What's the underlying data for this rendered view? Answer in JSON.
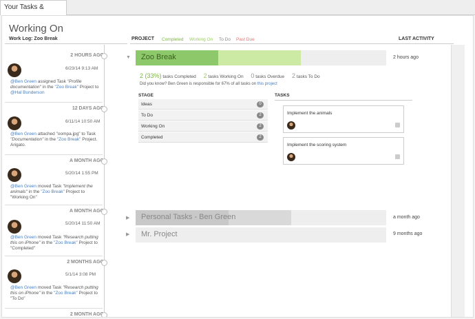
{
  "tab": {
    "label": "Your Tasks & Projects"
  },
  "header": {
    "title": "Working On",
    "worklog": "Work Log: Zoo Break",
    "project_col": "PROJECT",
    "legend": {
      "completed": "Completed",
      "working_on": "Working On",
      "to_do": "To Do",
      "past_due": "Past Due"
    },
    "activity_col": "LAST ACTIVITY"
  },
  "colors": {
    "completed": "#8dc96b",
    "working_on": "#cdeaa5",
    "past_due": "#e57373",
    "link": "#4a7fc0"
  },
  "feed": [
    {
      "time": "2 HOURS AGO",
      "date": "6/23/14 9:13 AM",
      "user": "@Ben Green",
      "action": " assigned Task ",
      "item": "\"Profile documentation\"",
      "mid": " in the ",
      "project": "\"Zoo Break\"",
      "tail": " Project to ",
      "target": "@Hal Bunderson",
      "end": ""
    },
    {
      "time": "12 DAYS AGO",
      "date": "6/11/14 10:50 AM",
      "user": "@Ben Green",
      "action": " attached \"oompa.jpg\" to Task ",
      "item": "\"Documentation\"",
      "mid": " in the ",
      "project": "\"Zoo Break\"",
      "tail": " Project. Arigato.",
      "target": "",
      "end": ""
    },
    {
      "time": "A MONTH AGO",
      "date": "5/20/14 1:55 PM",
      "user": "@Ben Green",
      "action": " moved Task ",
      "item": "\"Implement the animals\"",
      "mid": " in the ",
      "project": "\"Zoo Break\"",
      "tail": " Project to \"Working On\"",
      "target": "",
      "end": ""
    },
    {
      "time": "A MONTH AGO",
      "date": "5/20/14 11:50 AM",
      "user": "@Ben Green",
      "action": " moved Task ",
      "item": "\"Research putting this on iPhone\"",
      "mid": " in the ",
      "project": "\"Zoo Break\"",
      "tail": " Project to \"Completed\"",
      "target": "",
      "end": ""
    },
    {
      "time": "2 MONTHS AGO",
      "date": "5/1/14 3:08 PM",
      "user": "@Ben Green",
      "action": " moved Task ",
      "item": "\"Research putting this on iPhone\"",
      "mid": " in the ",
      "project": "\"Zoo Break\"",
      "tail": " Project to \"To Do\"",
      "target": "",
      "end": ""
    },
    {
      "time": "2 MONTH AGO"
    }
  ],
  "projects": [
    {
      "name": "Zoo Break",
      "activity": "2 hours ago",
      "completed_fraction": 0.33,
      "working_fraction": 0.33,
      "stats": {
        "completed": "2 (33%)",
        "completed_label": " tasks Completed",
        "working": "2",
        "working_label": " tasks Working On",
        "overdue": "0",
        "overdue_label": " tasks Overdue",
        "todo": "2",
        "todo_label": " tasks To Do"
      },
      "hint": "Did you know? Ben Green is responsible for 67% of all tasks on ",
      "hint_link": "this project",
      "stage_header": "STAGE",
      "tasks_header": "TASKS",
      "stages": [
        {
          "name": "Ideas",
          "count": "0"
        },
        {
          "name": "To Do",
          "count": "2"
        },
        {
          "name": "Working On",
          "count": "2"
        },
        {
          "name": "Completed",
          "count": "2"
        }
      ],
      "tasks": [
        {
          "name": "Implement the animals"
        },
        {
          "name": "Implement the scoring system"
        }
      ]
    },
    {
      "name": "Personal Tasks - Ben Green",
      "activity": "a month ago",
      "completed_fraction": 0.37,
      "working_fraction": 0.25
    },
    {
      "name": "Mr. Project",
      "activity": "9 months ago",
      "completed_fraction": 0,
      "working_fraction": 0
    }
  ]
}
